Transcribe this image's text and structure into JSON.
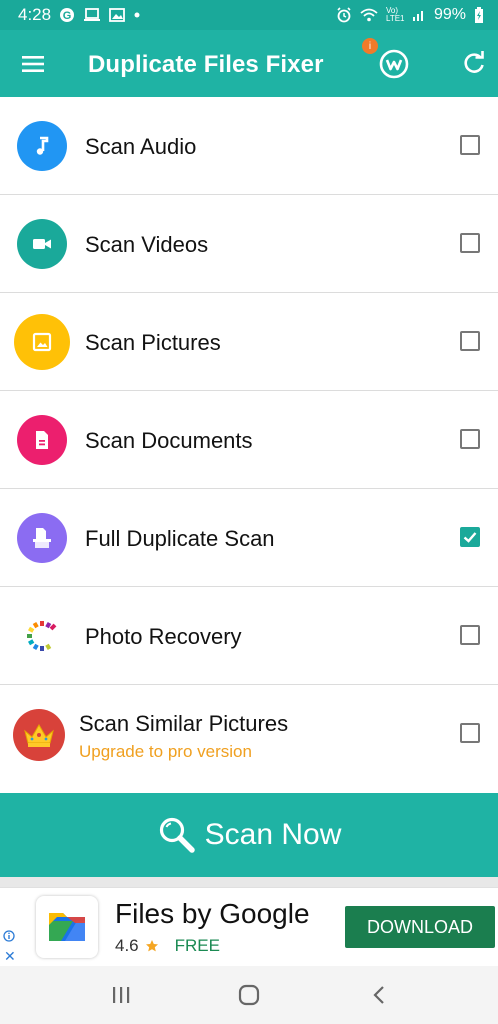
{
  "status_bar": {
    "time": "4:28",
    "battery": "99%",
    "lte_label": "Vo) LTE1"
  },
  "app_bar": {
    "title": "Duplicate Files Fixer",
    "badge": "i"
  },
  "scan_items": [
    {
      "label": "Scan Audio",
      "icon": "music-note-icon",
      "color": "#2196f3",
      "checked": false
    },
    {
      "label": "Scan Videos",
      "icon": "video-camera-icon",
      "color": "#1aa99a",
      "checked": false
    },
    {
      "label": "Scan Pictures",
      "icon": "image-icon",
      "color": "#ffc107",
      "checked": false
    },
    {
      "label": "Scan Documents",
      "icon": "document-icon",
      "color": "#ec1f6e",
      "checked": false
    },
    {
      "label": "Full Duplicate Scan",
      "icon": "duplicate-files-icon",
      "color": "#8b6cf2",
      "checked": true
    },
    {
      "label": "Photo Recovery",
      "icon": "photo-recovery-icon",
      "color": "#ffffff",
      "checked": false
    },
    {
      "label": "Scan Similar Pictures",
      "sublabel": "Upgrade to pro version",
      "icon": "crown-icon",
      "color": "#d8423a",
      "checked": false
    }
  ],
  "scan_now": {
    "label": "Scan Now",
    "icon": "magnifier-icon"
  },
  "ad": {
    "title": "Files by Google",
    "rating": "4.6",
    "price": "FREE",
    "download_label": "DOWNLOAD",
    "close": "✕"
  },
  "colors": {
    "primary": "#1fb3a4",
    "status": "#1aa99a",
    "upgrade": "#f0a020",
    "download": "#1b7e4f"
  }
}
